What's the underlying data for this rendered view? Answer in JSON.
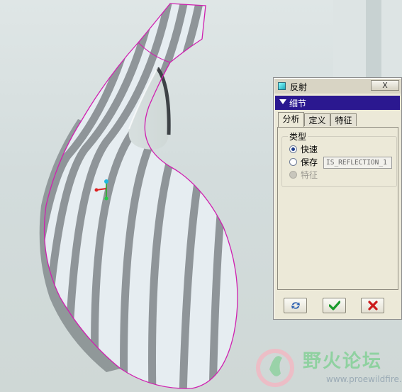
{
  "dialog": {
    "title": "反射",
    "close_label": "X",
    "section_title": "细节",
    "tabs": [
      {
        "label": "分析",
        "active": true
      },
      {
        "label": "定义",
        "active": false
      },
      {
        "label": "特征",
        "active": false
      }
    ],
    "type_group": {
      "legend": "类型",
      "options": [
        {
          "label": "快速",
          "checked": true,
          "disabled": false
        },
        {
          "label": "保存",
          "checked": false,
          "disabled": false
        },
        {
          "label": "特征",
          "checked": false,
          "disabled": true
        }
      ],
      "save_name_value": "IS_REFLECTION_1"
    },
    "buttons": {
      "repaint": "repaint-icon",
      "ok": "checkmark-icon",
      "cancel": "x-icon"
    }
  },
  "watermark": {
    "title": "野火论坛",
    "url": "www.proewildfire.cn"
  },
  "colors": {
    "section_header": "#2b1890",
    "surface_light": "#e8eef2",
    "surface_stripe": "#8f9599",
    "edge_highlight": "#d020b0"
  }
}
